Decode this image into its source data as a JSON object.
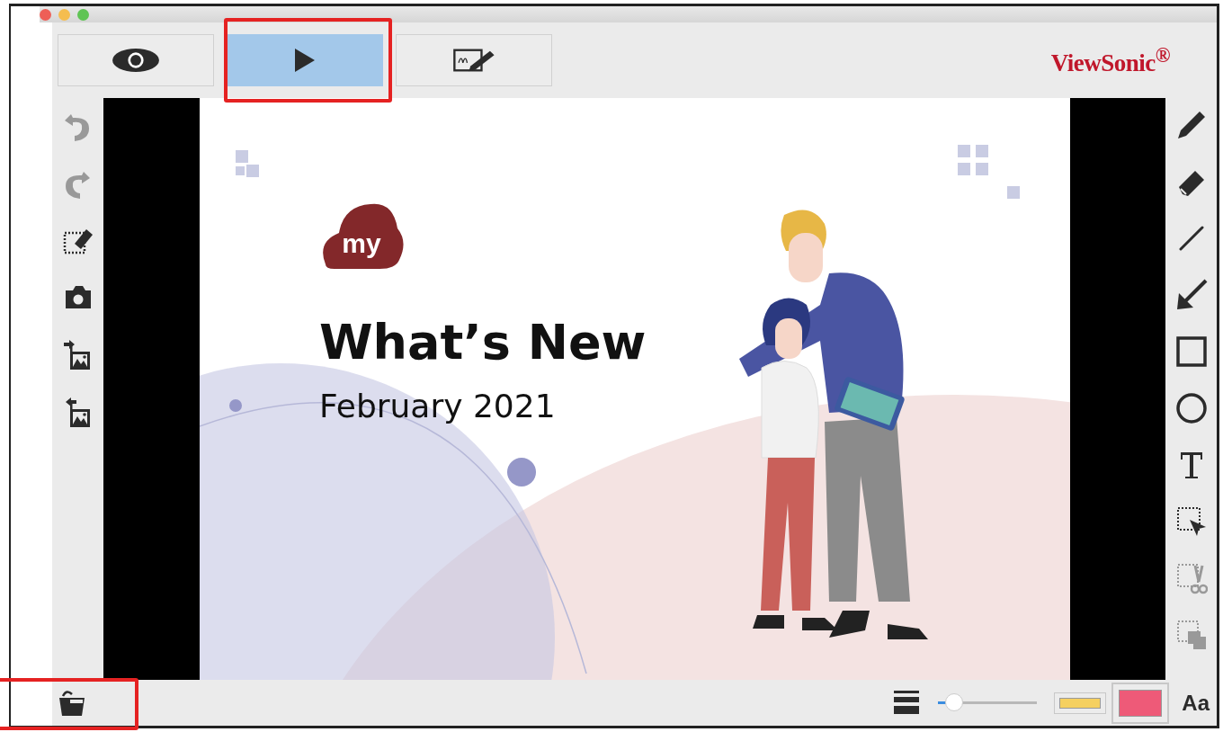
{
  "window": {
    "traffic_lights": [
      {
        "color": "#ee5f57"
      },
      {
        "color": "#f5bd4f"
      },
      {
        "color": "#5fc454"
      }
    ]
  },
  "mode_buttons": [
    {
      "kind": "view",
      "selected": false,
      "highlighted": false
    },
    {
      "kind": "play",
      "selected": true,
      "highlighted": true
    },
    {
      "kind": "annotate",
      "selected": false,
      "highlighted": false
    }
  ],
  "brand": "ViewSonic$^{®}$",
  "left_tools": [
    {
      "kind": "undo",
      "disabled": true
    },
    {
      "kind": "redo",
      "disabled": true
    },
    {
      "kind": "clear",
      "disabled": false
    },
    {
      "kind": "camera",
      "disabled": false
    },
    {
      "kind": "import",
      "disabled": false
    },
    {
      "kind": "export",
      "disabled": false
    }
  ],
  "right_tools": [
    {
      "kind": "pen",
      "disabled": false
    },
    {
      "kind": "eraser",
      "disabled": false
    },
    {
      "kind": "line",
      "disabled": false
    },
    {
      "kind": "arrow",
      "disabled": false
    },
    {
      "kind": "rectangle",
      "disabled": false
    },
    {
      "kind": "ellipse",
      "disabled": false
    },
    {
      "kind": "text",
      "disabled": false
    },
    {
      "kind": "select",
      "disabled": false
    },
    {
      "kind": "cut",
      "disabled": true
    },
    {
      "kind": "copy",
      "disabled": true
    }
  ],
  "slide": {
    "logo": "my",
    "title": "What’s New",
    "subtitle": "February 2021"
  },
  "bottom_bar": {
    "open_highlighted": true,
    "stroke_width": {
      "level": 0.16
    },
    "swatches": [
      {
        "kind": "highlighter",
        "color": "#f5d060",
        "selected": false
      },
      {
        "kind": "pen",
        "color": "#ee5a78",
        "selected": true
      }
    ],
    "font_button": "Aa"
  }
}
